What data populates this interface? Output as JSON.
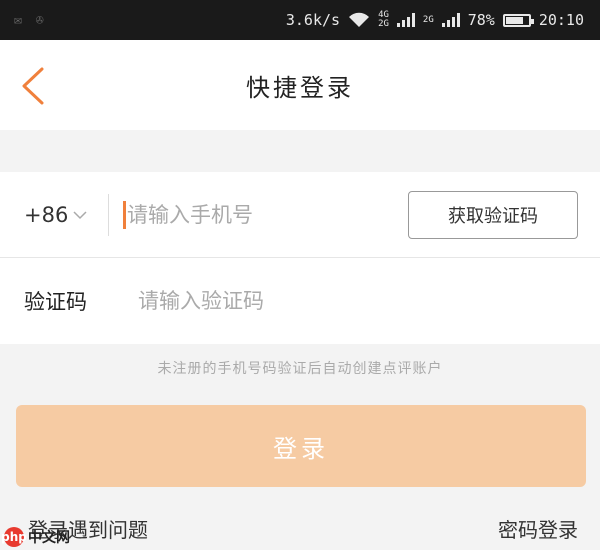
{
  "status_bar": {
    "speed": "3.6k/s",
    "net_a": "4G",
    "net_b": "2G",
    "net_c": "2G",
    "battery": "78%",
    "battery_level": 0.78,
    "time": "20:10"
  },
  "header": {
    "back_icon": "chevron-left-icon",
    "title": "快捷登录"
  },
  "form": {
    "country_code": "+86",
    "phone_placeholder": "请输入手机号",
    "get_code_label": "获取验证码",
    "code_label": "验证码",
    "code_placeholder": "请输入验证码"
  },
  "hint": "未注册的手机号码验证后自动创建点评账户",
  "login_label": "登录",
  "footer": {
    "trouble_label": "登录遇到问题",
    "password_login_label": "密码登录"
  },
  "watermark": {
    "logo_char": "php",
    "text": "中文网"
  },
  "colors": {
    "accent": "#f0803c",
    "button_bg": "#f6cba3",
    "status_bar_bg": "#1a1a1a"
  }
}
